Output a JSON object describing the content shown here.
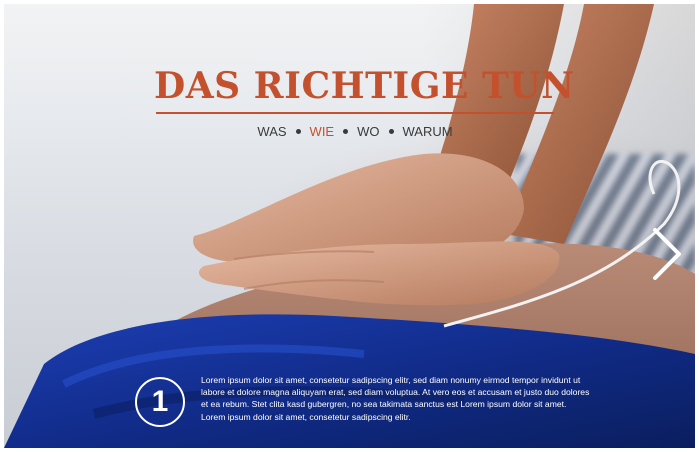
{
  "hero": {
    "title": "DAS RICHTIGE TUN",
    "accent_color": "#c4512e"
  },
  "subnav": {
    "items": [
      {
        "label": "WAS",
        "active": false
      },
      {
        "label": "WIE",
        "active": true
      },
      {
        "label": "WO",
        "active": false
      },
      {
        "label": "WARUM",
        "active": false
      }
    ]
  },
  "navigation": {
    "next_icon": "chevron-right-icon"
  },
  "step": {
    "number": "1",
    "text": "Lorem ipsum dolor sit amet, consetetur sadipscing elitr, sed diam nonumy eirmod tempor invidunt ut labore et dolore magna aliquyam erat, sed diam voluptua. At vero eos et accusam et justo duo dolores et ea rebum. Stet clita kasd gubergren, no sea takimata sanctus est Lorem ipsum dolor sit amet. Lorem ipsum dolor sit amet, consetetur sadipscing elitr."
  }
}
